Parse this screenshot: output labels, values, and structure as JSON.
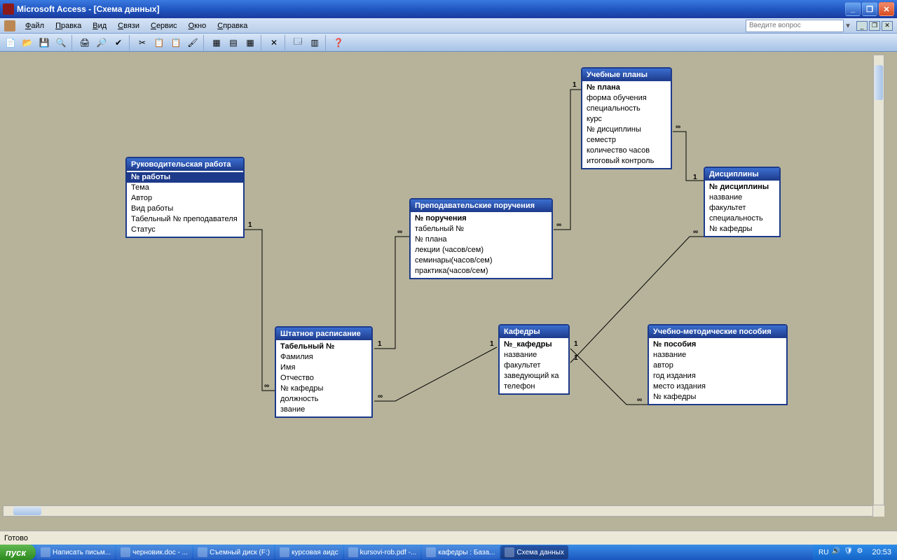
{
  "app_title": "Microsoft Access - [Схема данных]",
  "menus": [
    "Файл",
    "Правка",
    "Вид",
    "Связи",
    "Сервис",
    "Окно",
    "Справка"
  ],
  "question_placeholder": "Введите вопрос",
  "status_text": "Готово",
  "tables": {
    "t1": {
      "title": "Руководительская работа",
      "fields": [
        {
          "name": "№ работы",
          "pk": true,
          "selected": true
        },
        {
          "name": "Тема"
        },
        {
          "name": "Автор"
        },
        {
          "name": "Вид работы"
        },
        {
          "name": "Табельный № преподавателя"
        },
        {
          "name": "Статус"
        }
      ]
    },
    "t2": {
      "title": "Преподавательские поручения",
      "fields": [
        {
          "name": "№ поручения",
          "pk": true
        },
        {
          "name": "табельный №"
        },
        {
          "name": "№ плана"
        },
        {
          "name": "лекции (часов/сем)"
        },
        {
          "name": "семинары(часов/сем)"
        },
        {
          "name": "практика(часов/сем)"
        }
      ]
    },
    "t3": {
      "title": "Учебные планы",
      "fields": [
        {
          "name": "№ плана",
          "pk": true
        },
        {
          "name": "форма обучения"
        },
        {
          "name": "специальность"
        },
        {
          "name": "курс"
        },
        {
          "name": "№ дисциплины"
        },
        {
          "name": "семестр"
        },
        {
          "name": "количество часов"
        },
        {
          "name": "итоговый контроль"
        }
      ]
    },
    "t4": {
      "title": "Дисциплины",
      "fields": [
        {
          "name": "№ дисциплины",
          "pk": true
        },
        {
          "name": "название"
        },
        {
          "name": "факультет"
        },
        {
          "name": "специальность"
        },
        {
          "name": "№ кафедры"
        }
      ]
    },
    "t5": {
      "title": "Штатное расписание",
      "fields": [
        {
          "name": "Табельный №",
          "pk": true
        },
        {
          "name": "Фамилия"
        },
        {
          "name": "Имя"
        },
        {
          "name": "Отчество"
        },
        {
          "name": "№ кафедры"
        },
        {
          "name": "должность"
        },
        {
          "name": "звание"
        }
      ]
    },
    "t6": {
      "title": "Кафедры",
      "fields": [
        {
          "name": "№_кафедры",
          "pk": true
        },
        {
          "name": "название"
        },
        {
          "name": "факультет"
        },
        {
          "name": "заведующий ка"
        },
        {
          "name": "телефон"
        }
      ]
    },
    "t7": {
      "title": "Учебно-методические пособия",
      "fields": [
        {
          "name": "№ пособия",
          "pk": true
        },
        {
          "name": "название"
        },
        {
          "name": "автор"
        },
        {
          "name": "год издания"
        },
        {
          "name": "место издания"
        },
        {
          "name": "№  кафедры"
        }
      ]
    }
  },
  "rel_labels": {
    "one": "1",
    "many": "∞"
  },
  "taskbar": {
    "start": "пуск",
    "items": [
      "Написать письм...",
      "черновик.doc - ...",
      "Съемный диск (F:)",
      "курсовая аидс",
      "kursovi-rob.pdf -...",
      "кафедры : База...",
      "Схема данных"
    ],
    "lang": "RU",
    "clock": "20:53"
  }
}
